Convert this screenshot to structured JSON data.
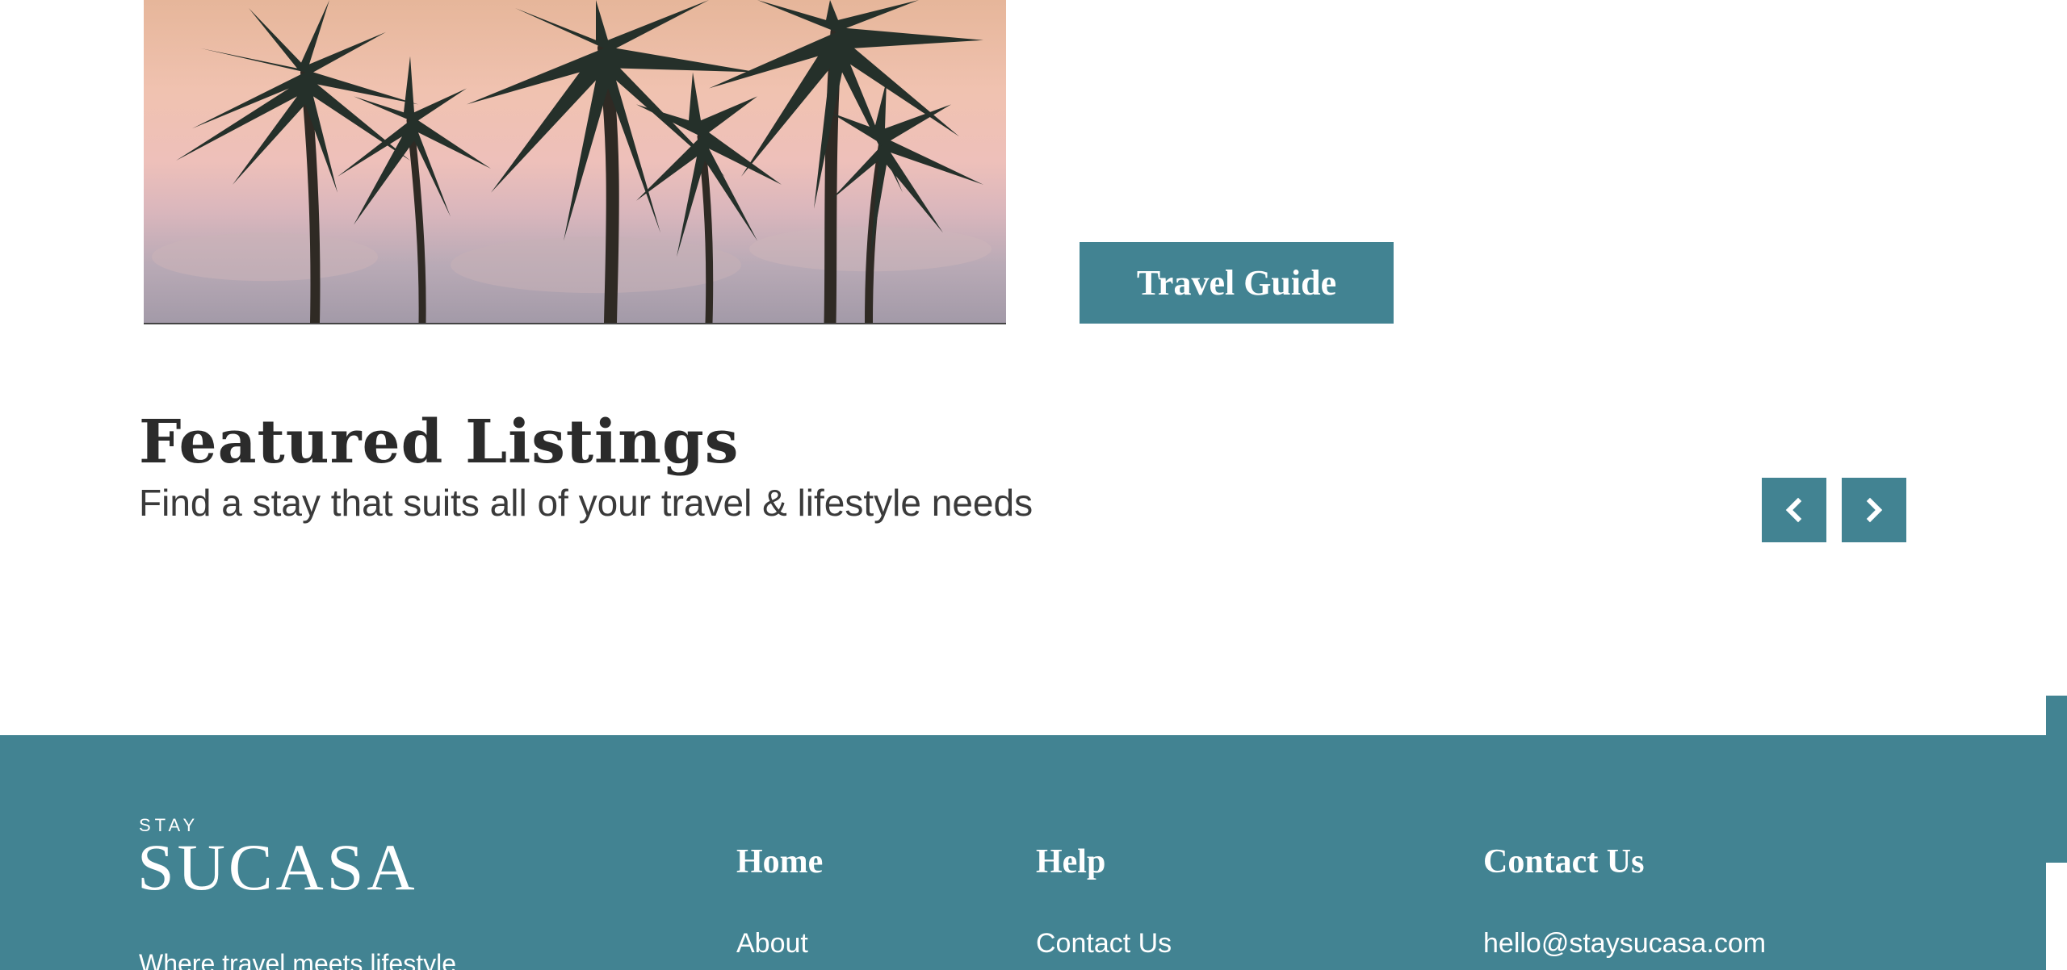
{
  "hero": {
    "image_name": "palm-trees-sunset",
    "travel_guide_label": "Travel Guide"
  },
  "featured": {
    "title": "Featured Listings",
    "subtitle": "Find a stay that suits all of your travel & lifestyle needs",
    "prev_icon": "chevron-left-icon",
    "next_icon": "chevron-right-icon"
  },
  "footer": {
    "brand_small": "STAY",
    "brand_large": "SUCASA",
    "tagline": "Where travel meets lifestyle",
    "columns": [
      {
        "heading": "Home",
        "link": "About"
      },
      {
        "heading": "Help",
        "link": "Contact Us"
      },
      {
        "heading": "Contact Us",
        "link": "hello@staysucasa.com"
      }
    ]
  },
  "colors": {
    "accent": "#428392",
    "heading_text": "#2b2b2b",
    "body_text": "#3a3a3a"
  }
}
